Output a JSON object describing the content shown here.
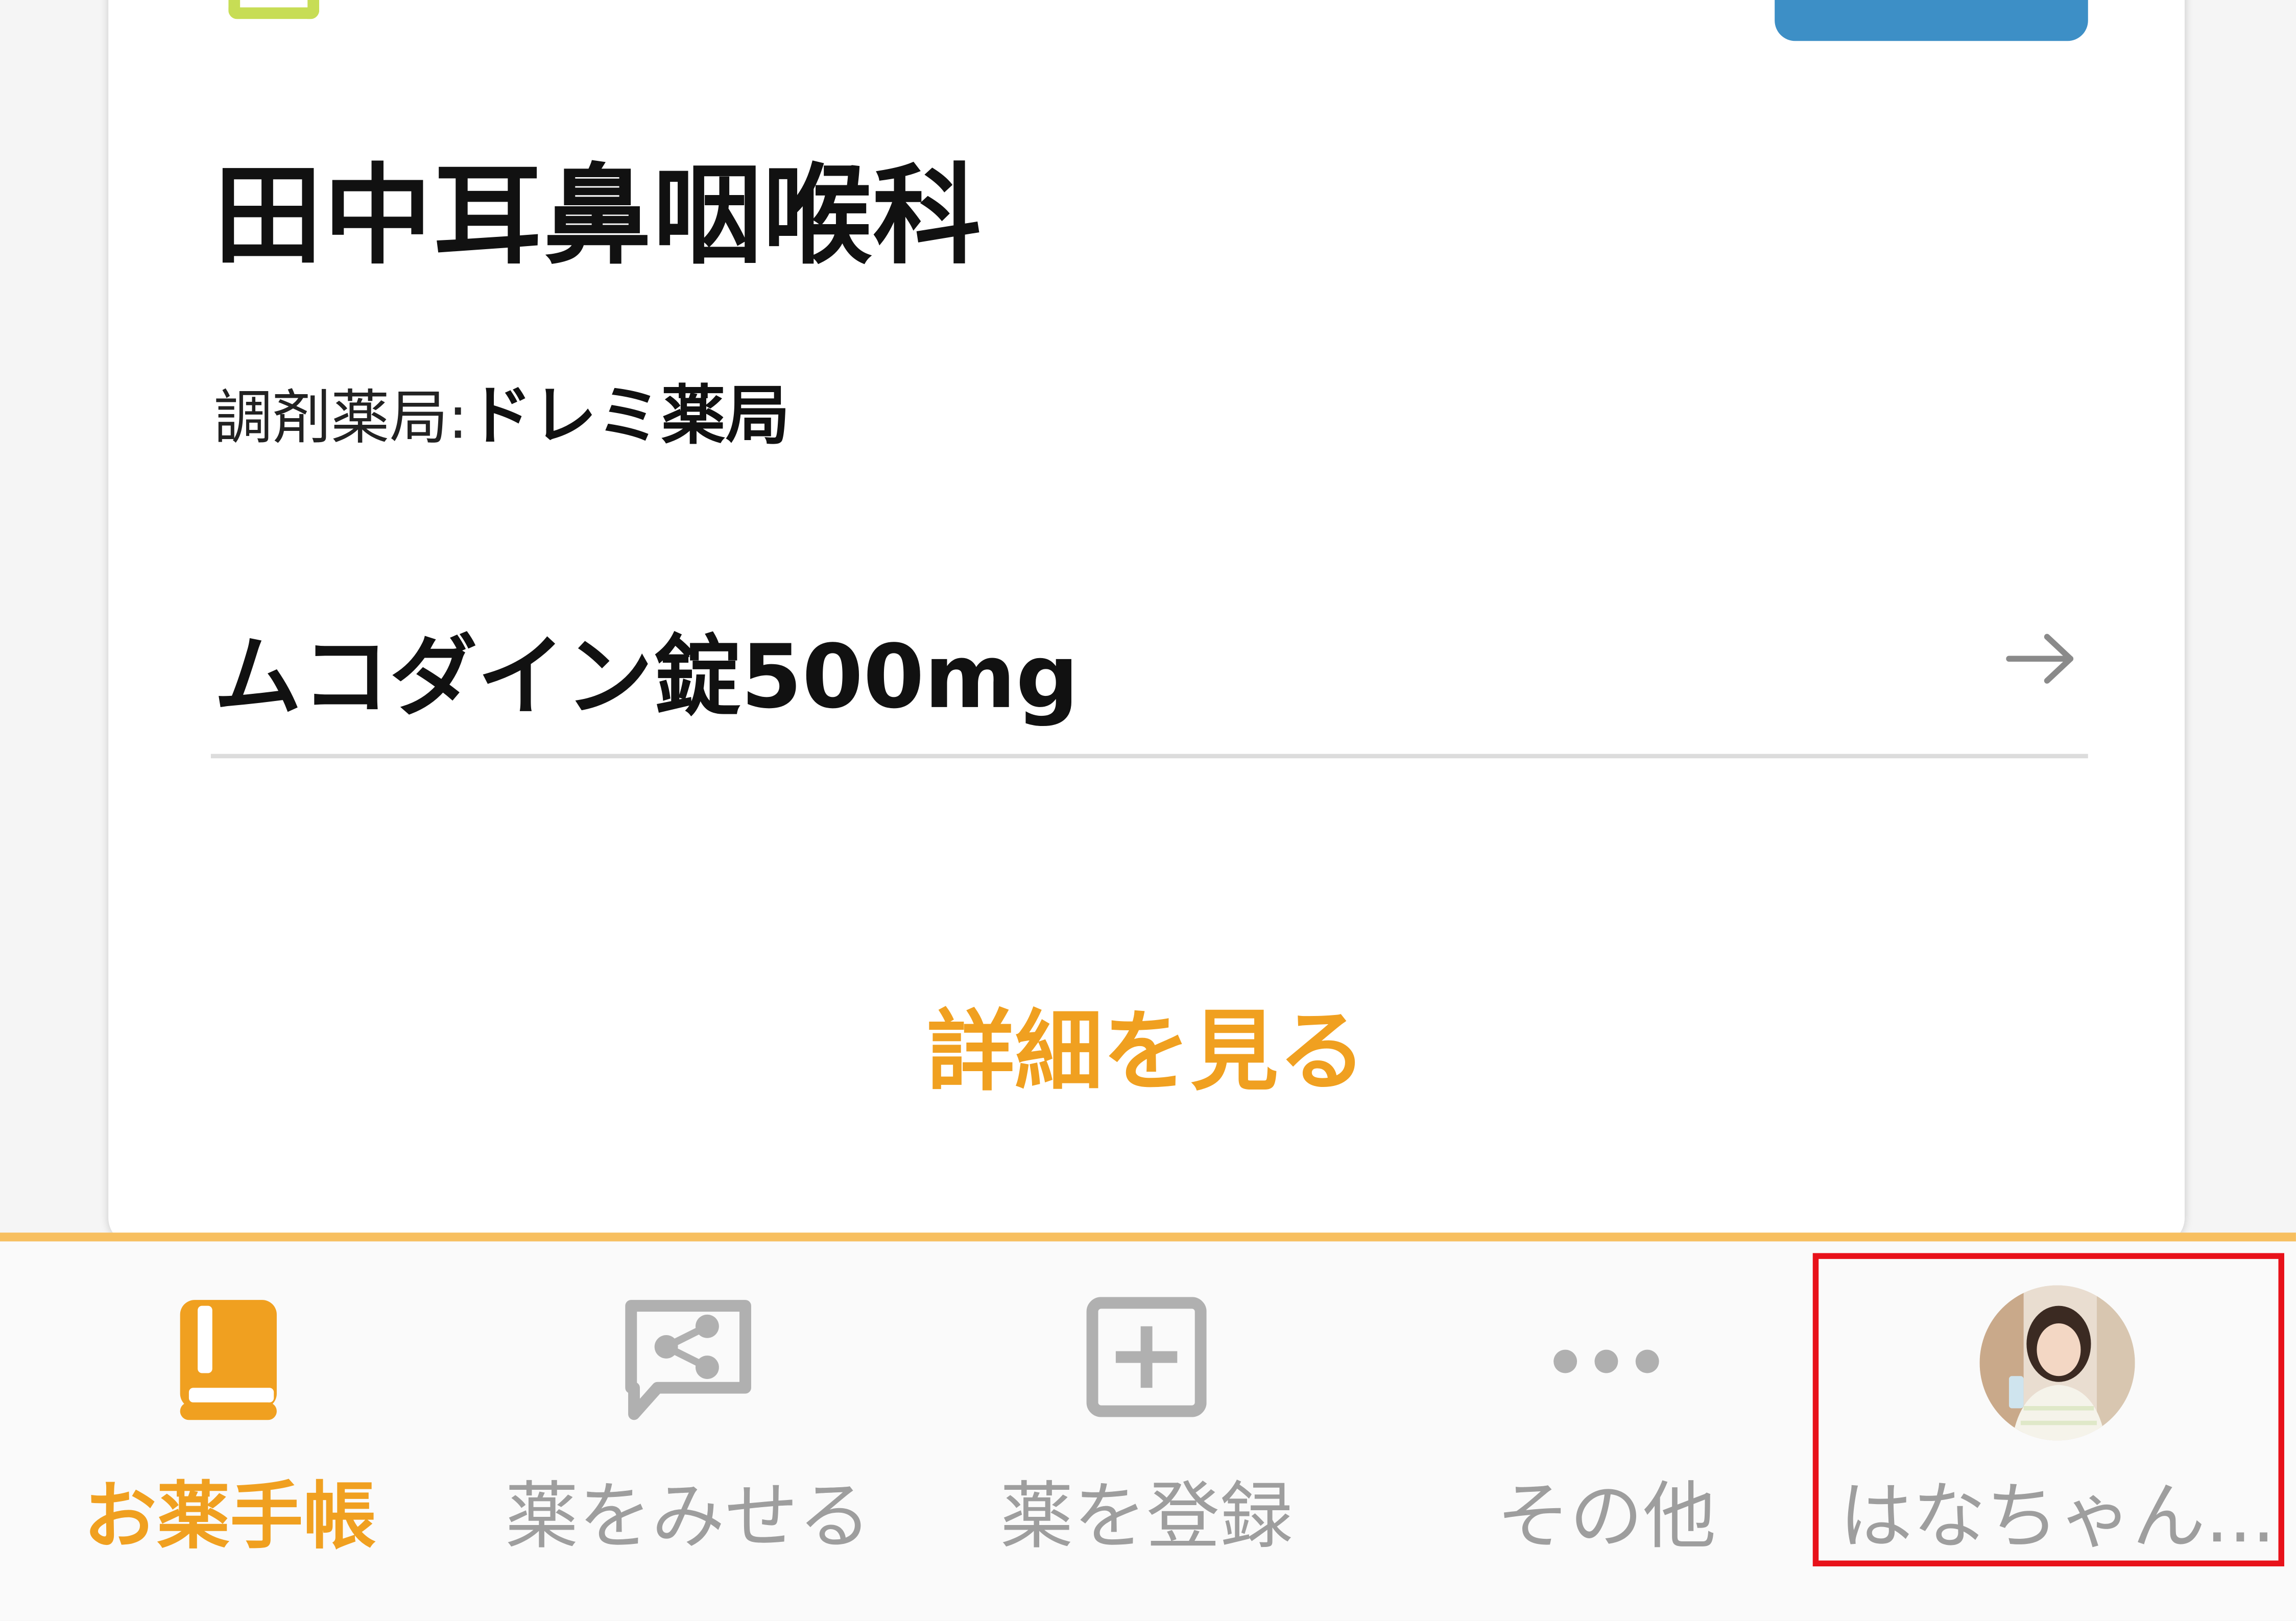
{
  "colors": {
    "accent": "#f0a020",
    "tab_inactive": "#9e9e9e",
    "tabbar_border": "#f7bf60",
    "button_blue": "#3d8fc6",
    "highlight": "#e8121a"
  },
  "card": {
    "clinic_name": "田中耳鼻咽喉科",
    "pharmacy_label": "調剤薬局:",
    "pharmacy_name": "ドレミ薬局",
    "drug_name": "ムコダイン錠500mg",
    "details_link": "詳細を見る"
  },
  "tabbar": {
    "tabs": [
      {
        "label": "お薬手帳",
        "icon": "book-icon",
        "active": true
      },
      {
        "label": "薬をみせる",
        "icon": "share-icon",
        "active": false
      },
      {
        "label": "薬を登録",
        "icon": "add-square-icon",
        "active": false
      },
      {
        "label": "その他",
        "icon": "more-dots-icon",
        "active": false
      },
      {
        "label": "はなちゃん...",
        "icon": "avatar",
        "active": false
      }
    ]
  }
}
